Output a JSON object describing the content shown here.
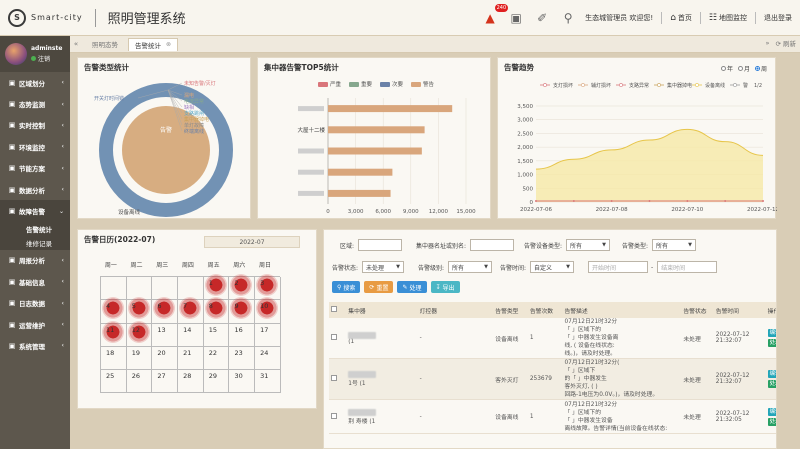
{
  "header": {
    "logo_mark": "S",
    "logo_text": "Smart-city",
    "title": "照明管理系统",
    "alarm_count": "240",
    "user_greeting": "生态城管理员 欢迎您!",
    "home_label": "首页",
    "map_label": "地图监控",
    "logout_label": "退出登录"
  },
  "sidebar": {
    "user_name": "adminste",
    "user_status": "注销",
    "items": [
      {
        "label": "区域划分",
        "icon": "grid-icon"
      },
      {
        "label": "态势监测",
        "icon": "radar-icon"
      },
      {
        "label": "实时控制",
        "icon": "control-icon"
      },
      {
        "label": "环境监控",
        "icon": "environment-icon"
      },
      {
        "label": "节能方案",
        "icon": "leaf-icon"
      },
      {
        "label": "数据分析",
        "icon": "chart-icon"
      },
      {
        "label": "故障告警",
        "icon": "alarm-icon"
      }
    ],
    "sub_items": [
      {
        "label": "告警统计"
      },
      {
        "label": "维修记录"
      }
    ],
    "items_after": [
      {
        "label": "周报分析",
        "icon": "report-icon"
      },
      {
        "label": "基础信息",
        "icon": "info-icon"
      },
      {
        "label": "日志数据",
        "icon": "log-icon"
      },
      {
        "label": "运营维护",
        "icon": "wrench-icon"
      },
      {
        "label": "系统管理",
        "icon": "settings-icon"
      }
    ]
  },
  "tabs": {
    "items": [
      {
        "label": "照明态势"
      },
      {
        "label": "告警统计"
      }
    ],
    "refresh_label": "刷新"
  },
  "panels": {
    "type_title": "告警类型统计",
    "top5_title": "集中器告警TOP5统计",
    "trend_title": "告警趋势",
    "calendar_title": "告警日历(2022-07)"
  },
  "donut": {
    "inner_label": "告警",
    "outer_label": "设备离线",
    "callouts": [
      "未知告警/灭灯",
      "开关灯时间错",
      "漏电",
      "电流异常",
      "缺相",
      "支路跳闸",
      "集中器掉电",
      "单灯故障",
      "终端离线",
      "设备离线"
    ]
  },
  "bar_legend": [
    {
      "name": "严重",
      "color": "#d9757a"
    },
    {
      "name": "重要",
      "color": "#86a88e"
    },
    {
      "name": "次要",
      "color": "#6b82a8"
    },
    {
      "name": "警告",
      "color": "#d9a67c"
    }
  ],
  "chart_data": [
    {
      "type": "bar",
      "categories": [
        "",
        "",
        "",
        "大屋十二楼",
        ""
      ],
      "series": [
        {
          "name": "严重",
          "values": [
            0,
            0,
            0,
            0,
            0
          ]
        },
        {
          "name": "重要",
          "values": [
            0,
            0,
            0,
            0,
            0
          ]
        },
        {
          "name": "次要",
          "values": [
            0,
            0,
            0,
            0,
            0
          ]
        },
        {
          "name": "警告",
          "values": [
            6800,
            7000,
            10200,
            10500,
            13500
          ]
        }
      ],
      "x_ticks": [
        "0",
        "3,000",
        "6,000",
        "9,000",
        "12,000",
        "15,000"
      ],
      "xlim": [
        0,
        15000
      ],
      "orientation": "horizontal",
      "grid": true
    },
    {
      "type": "area",
      "x": [
        "2022-07-06",
        "2022-07-07",
        "2022-07-08",
        "2022-07-09",
        "2022-07-10",
        "2022-07-11",
        "2022-07-12"
      ],
      "x_ticks": [
        "2022-07-06",
        "2022-07-08",
        "2022-07-10",
        "2022-07-12"
      ],
      "series": [
        {
          "name": "设备离线",
          "values": [
            1200,
            1560,
            1900,
            2260,
            2650,
            2200,
            1700
          ]
        },
        {
          "name": "支路跳闸",
          "values": [
            0,
            0,
            0,
            0,
            0,
            0,
            0
          ]
        },
        {
          "name": "辅灯损坏",
          "values": [
            0,
            0,
            0,
            0,
            0,
            0,
            0
          ]
        },
        {
          "name": "支路异常",
          "values": [
            0,
            0,
            0,
            0,
            0,
            0,
            0
          ]
        }
      ],
      "legend": [
        "支灯损坏",
        "辅灯损坏",
        "支路异常",
        "集中器掉电",
        "设备离线",
        "警"
      ],
      "legend_page": "1/2",
      "y_ticks": [
        "0",
        "500",
        "1,000",
        "1,500",
        "2,000",
        "2,500",
        "3,000",
        "3,500"
      ],
      "ylim": [
        0,
        3500
      ],
      "grid": true,
      "colors": {
        "line": "#e7c54a",
        "fill": "#f6e9a6"
      }
    }
  ],
  "trend_radios": [
    {
      "label": "年",
      "on": false
    },
    {
      "label": "月",
      "on": false
    },
    {
      "label": "周",
      "on": true
    }
  ],
  "calendar": {
    "month": "2022-07",
    "weekdays": [
      "周一",
      "周二",
      "周三",
      "周四",
      "周五",
      "周六",
      "周日"
    ],
    "weeks": [
      [
        "",
        "",
        "",
        "",
        "1",
        "2",
        "3"
      ],
      [
        "4",
        "5",
        "6",
        "7",
        "8",
        "9",
        "10"
      ],
      [
        "11",
        "12",
        "13",
        "14",
        "15",
        "16",
        "17"
      ],
      [
        "18",
        "19",
        "20",
        "21",
        "22",
        "23",
        "24"
      ],
      [
        "25",
        "26",
        "27",
        "28",
        "29",
        "30",
        "31"
      ]
    ],
    "alarm_days": [
      "1",
      "2",
      "3",
      "4",
      "5",
      "6",
      "7",
      "8",
      "9",
      "10",
      "11",
      "12"
    ]
  },
  "filters": {
    "area_label": "区域:",
    "concentrator_label": "集中器名址或别名:",
    "device_type_label": "告警设备类型:",
    "device_type_value": "所有",
    "alarm_type_label": "告警类型:",
    "alarm_type_value": "所有",
    "status_label": "告警状态:",
    "status_value": "未处理",
    "level_label": "告警级别:",
    "level_value": "所有",
    "time_label": "告警时间:",
    "time_value": "自定义",
    "start_placeholder": "开始时间",
    "end_placeholder": "结束时间",
    "search_btn": "搜索",
    "reset_btn": "重置",
    "handle_btn": "处理",
    "export_btn": "导出"
  },
  "table": {
    "headers": [
      "集中器",
      "灯控器",
      "告警类型",
      "告警次数",
      "告警描述",
      "告警状态",
      "告警时间",
      "操作"
    ],
    "rows": [
      {
        "concentrator": "(1",
        "lamp": "-",
        "type": "设备离线",
        "count": "1",
        "desc": [
          "07月12日21时32分",
          "「     」区域下的",
          "「      」中器发生设备离",
          "线, (      设备在线状态:",
          "线。)，请及时处理。"
        ],
        "status": "未处理",
        "time": [
          "2022-07-12",
          "21:32:07"
        ]
      },
      {
        "concentrator": "1号 (1",
        "lamp": "-",
        "type": "客外灭灯",
        "count": "253679",
        "desc": [
          "07月12日21时32分(     ",
          "「          」区域下",
          "的「      」中器发生",
          "客外灭灯, (       )",
          "回路-1电压为0.0V。)，请及时处理。"
        ],
        "status": "未处理",
        "time": [
          "2022-07-12",
          "21:32:07"
        ]
      },
      {
        "concentrator": "荆    寿楼 (1",
        "lamp": "-",
        "type": "设备离线",
        "count": "1",
        "desc": [
          "07月12日21时32分",
          "「       」区域下的",
          "「       」中器发生设备",
          "离线故障。告警详情(当前设备在线状态:"
        ],
        "status": "未处理",
        "time": [
          "2022-07-12",
          "21:32:05"
        ]
      }
    ],
    "edit_label": "编辑",
    "handle_label": "处理"
  }
}
